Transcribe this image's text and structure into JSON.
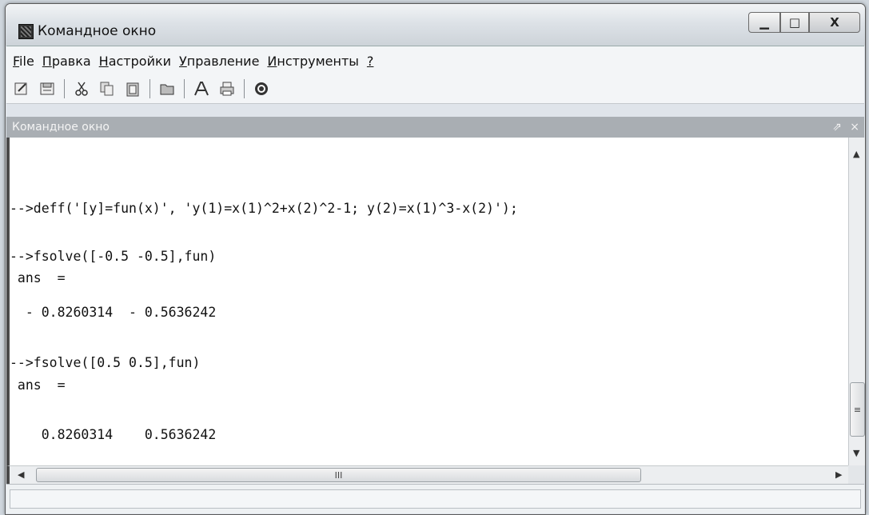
{
  "window": {
    "title": "Командное окно"
  },
  "menu": [
    "File",
    "Правка",
    "Настройки",
    "Управление",
    "Инструменты",
    "?"
  ],
  "toolbar": [
    "new-script-icon",
    "load-icon",
    "cut-icon",
    "copy-icon",
    "paste-icon",
    "open-folder-icon",
    "font-icon",
    "print-icon",
    "help-icon"
  ],
  "panel": {
    "title": "Командное окно",
    "undock_glyph": "⇗",
    "close_glyph": "×"
  },
  "console": {
    "lines": [
      "-->deff('[y]=fun(x)', 'y(1)=x(1)^2+x(2)^2-1; y(2)=x(1)^3-x(2)');",
      "-->fsolve([-0.5 -0.5],fun)",
      " ans  =",
      "  - 0.8260314  - 0.5636242",
      "-->fsolve([0.5 0.5],fun)",
      " ans  =",
      "    0.8260314    0.5636242"
    ]
  },
  "scrollbars": {
    "thumb_glyph_v": "≡",
    "thumb_glyph_h": "III"
  }
}
